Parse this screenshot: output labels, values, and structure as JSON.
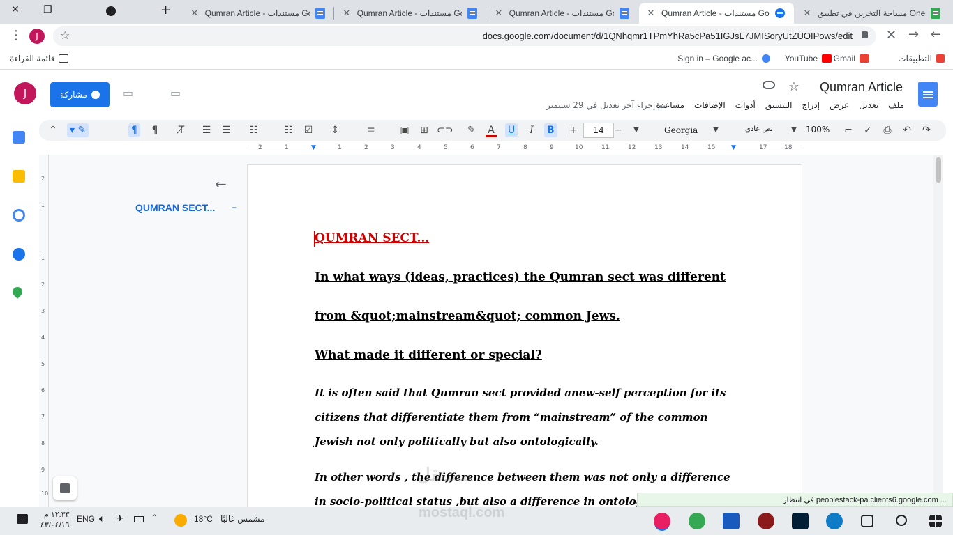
{
  "browser": {
    "tabs": [
      {
        "title": "مساحة التخزين في تطبيق One",
        "active": false
      },
      {
        "title": "Qumran Article - مستندات Go",
        "active": true
      },
      {
        "title": "Qumran Article - مستندات Go",
        "active": false
      },
      {
        "title": "Qumran Article - مستندات Go",
        "active": false
      },
      {
        "title": "Qumran Article - مستندات Go",
        "active": false
      }
    ],
    "url": "docs.google.com/document/d/1QNhqmr1TPmYhRa5cPa51IGJsL7JMISoryUtZUOIPows/edit",
    "avatar_letter": "J",
    "bookmarks": {
      "apps": "التطبيقات",
      "gmail": "Gmail",
      "youtube": "YouTube",
      "google_signin": "Sign in – Google ac...",
      "reading_list": "قائمة القراءة"
    }
  },
  "docs": {
    "title": "Qumran Article",
    "menu": [
      "ملف",
      "تعديل",
      "عرض",
      "إدراج",
      "التنسيق",
      "أدوات",
      "الإضافات",
      "مساعدة"
    ],
    "last_edit": "تم إجراء آخر تعديل في 29 سبتمبر",
    "share_label": "مشاركة",
    "avatar_letter": "J",
    "toolbar": {
      "zoom": "100%",
      "style": "نص عادي",
      "font": "Georgia",
      "size": "14",
      "bold": "B",
      "italic": "I",
      "underline": "U",
      "text_color": "A"
    },
    "ruler_labels": [
      "2",
      "1",
      "1",
      "2",
      "3",
      "4",
      "5",
      "6",
      "7",
      "8",
      "9",
      "10",
      "11",
      "12",
      "13",
      "14",
      "15",
      "16",
      "17",
      "18"
    ],
    "vruler_labels": [
      "2",
      "1",
      "1",
      "2",
      "3",
      "4",
      "5",
      "6",
      "7",
      "8",
      "9",
      "10"
    ],
    "outline_item": "QUMRAN SECT...",
    "content": {
      "heading": "QUMRAN SECT...",
      "q1_line1": "In what ways (ideas, practices) the Qumran sect was different",
      "q1_line2": "from &quot;mainstream&quot; common Jews.",
      "q2": "What made it different or special?",
      "p1_line1": "It is often said that Qumran sect provided anew-self perception for its",
      "p1_line2": "citizens that differentiate them from “mainstream” of the common",
      "p1_line3": "Jewish not only politically but also ontologically.",
      "p2_line1": "In other words , the difference between them was not only a difference",
      "p2_line2": "in socio-political status ,but also a difference in ontolog"
    }
  },
  "status_bar": "في انتظار peoplestack-pa.clients6.google.com ...",
  "taskbar": {
    "time": "١٢:٣٣ م",
    "date": "٤٣/٠٤/١٦",
    "lang": "ENG",
    "temperature": "18°C",
    "weather": "مشمس غالبًا"
  },
  "watermark": {
    "line1": "مستقل",
    "line2": "mostaql.com"
  },
  "colors": {
    "accent": "#1a73e8",
    "heading_red": "#cc0000",
    "avatar": "#c2185b"
  }
}
